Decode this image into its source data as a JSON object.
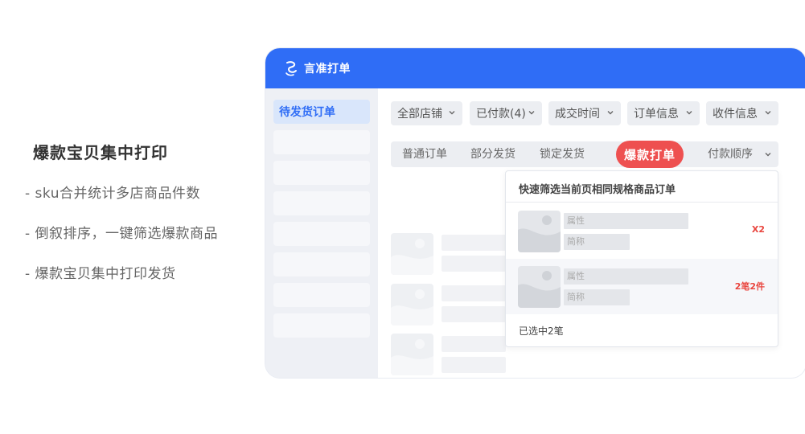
{
  "feature": {
    "title": "爆款宝贝集中打印",
    "points": [
      "- sku合并统计多店商品件数",
      "- 倒叙排序，一键筛选爆款商品",
      "- 爆款宝贝集中打印发货"
    ]
  },
  "app": {
    "title": "言准打单",
    "brand_color": "#2f6df6",
    "logo_icon": "logo-icon"
  },
  "sidebar": {
    "active_label": "待发货订单"
  },
  "filters": [
    {
      "label": "全部店铺"
    },
    {
      "label": "已付款(4)"
    },
    {
      "label": "成交时间"
    },
    {
      "label": "订单信息"
    },
    {
      "label": "收件信息"
    }
  ],
  "tabs": {
    "normal": "普通订单",
    "partial": "部分发货",
    "locked": "锁定发货",
    "hot": "爆款打单",
    "sort": "付款顺序",
    "hot_color": "#ee5050"
  },
  "dropdown": {
    "title": "快速筛选当前页相同规格商品订单",
    "rows": [
      {
        "attr": "属性",
        "short": "简称",
        "count": "X2"
      },
      {
        "attr": "属性",
        "short": "简称",
        "count": "2笔2件"
      }
    ],
    "footer": "已选中2笔",
    "count_color": "#e9453e"
  }
}
